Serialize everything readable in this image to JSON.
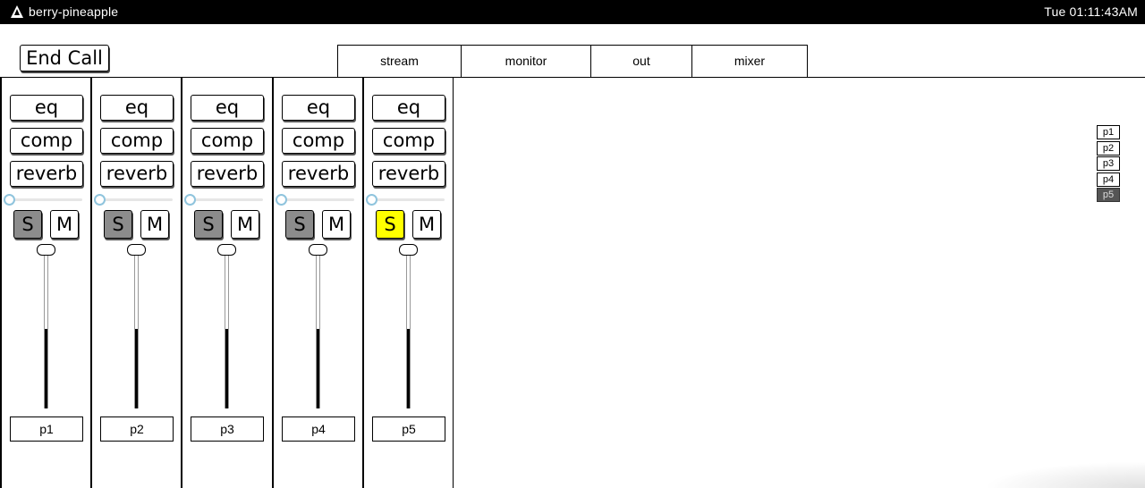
{
  "topbar": {
    "host": "berry-pineapple",
    "clock": "Tue 01:11:43AM",
    "logo_icon": "cone-icon"
  },
  "end_call_label": "End Call",
  "tabs": [
    {
      "label": "stream"
    },
    {
      "label": "monitor"
    },
    {
      "label": "out"
    },
    {
      "label": "mixer"
    }
  ],
  "strips": [
    {
      "eq": "eq",
      "comp": "comp",
      "reverb": "reverb",
      "solo": "S",
      "mute": "M",
      "name": "p1",
      "solo_active": false,
      "fader_level": 0.5,
      "pan": 0
    },
    {
      "eq": "eq",
      "comp": "comp",
      "reverb": "reverb",
      "solo": "S",
      "mute": "M",
      "name": "p2",
      "solo_active": false,
      "fader_level": 0.5,
      "pan": 0
    },
    {
      "eq": "eq",
      "comp": "comp",
      "reverb": "reverb",
      "solo": "S",
      "mute": "M",
      "name": "p3",
      "solo_active": false,
      "fader_level": 0.5,
      "pan": 0
    },
    {
      "eq": "eq",
      "comp": "comp",
      "reverb": "reverb",
      "solo": "S",
      "mute": "M",
      "name": "p4",
      "solo_active": false,
      "fader_level": 0.5,
      "pan": 0
    },
    {
      "eq": "eq",
      "comp": "comp",
      "reverb": "reverb",
      "solo": "S",
      "mute": "M",
      "name": "p5",
      "solo_active": true,
      "fader_level": 0.5,
      "pan": 0
    }
  ],
  "legend": [
    {
      "label": "p1",
      "selected": false
    },
    {
      "label": "p2",
      "selected": false
    },
    {
      "label": "p3",
      "selected": false
    },
    {
      "label": "p4",
      "selected": false
    },
    {
      "label": "p5",
      "selected": true
    }
  ],
  "colors": {
    "solo_active": "#ffff00",
    "solo_inactive": "#8c8c8c",
    "pan_knob": "#8fc4dd"
  }
}
